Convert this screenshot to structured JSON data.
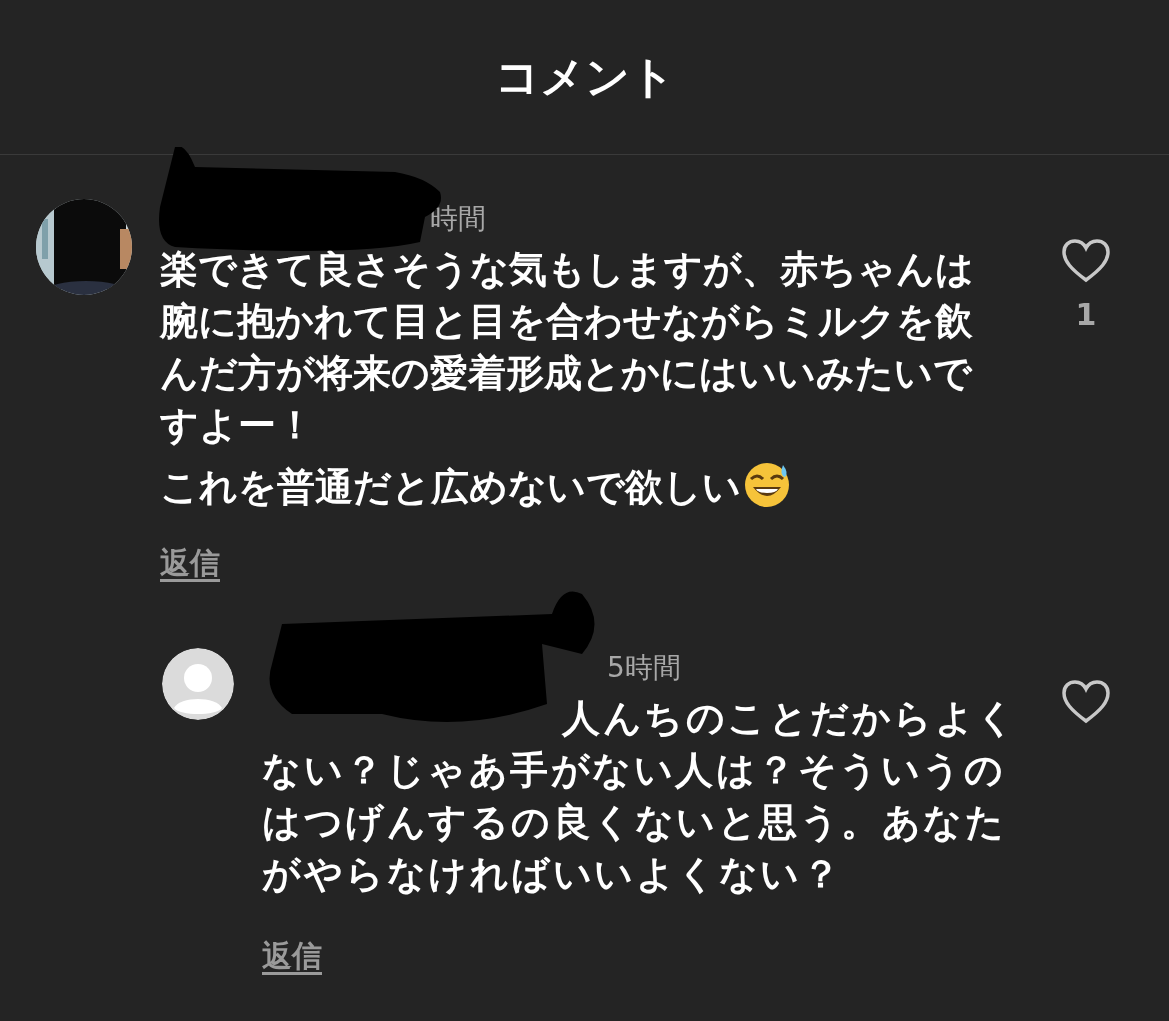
{
  "header": {
    "title": "コメント"
  },
  "comments": [
    {
      "time": "時間",
      "paragraphs": [
        "楽できて良さそうな気もしますが、赤ちゃんは腕に抱かれて目と目を合わせながらミルクを飲んだ方が将来の愛着形成とかにはいいみたいですよー！",
        "これを普通だと広めないで欲しい"
      ],
      "emoji_end": true,
      "reply_label": "返信",
      "like_count": "1",
      "kind": "comment",
      "mention": false,
      "liked": false
    },
    {
      "time": "5時間",
      "paragraphs": [
        "人んちのことだからよくない？じゃあ手がない人は？そういうのはつげんするの良くないと思う。あなたがやらなければいいよくない？"
      ],
      "emoji_end": false,
      "reply_label": "返信",
      "kind": "reply",
      "mention": true,
      "liked": false
    }
  ]
}
